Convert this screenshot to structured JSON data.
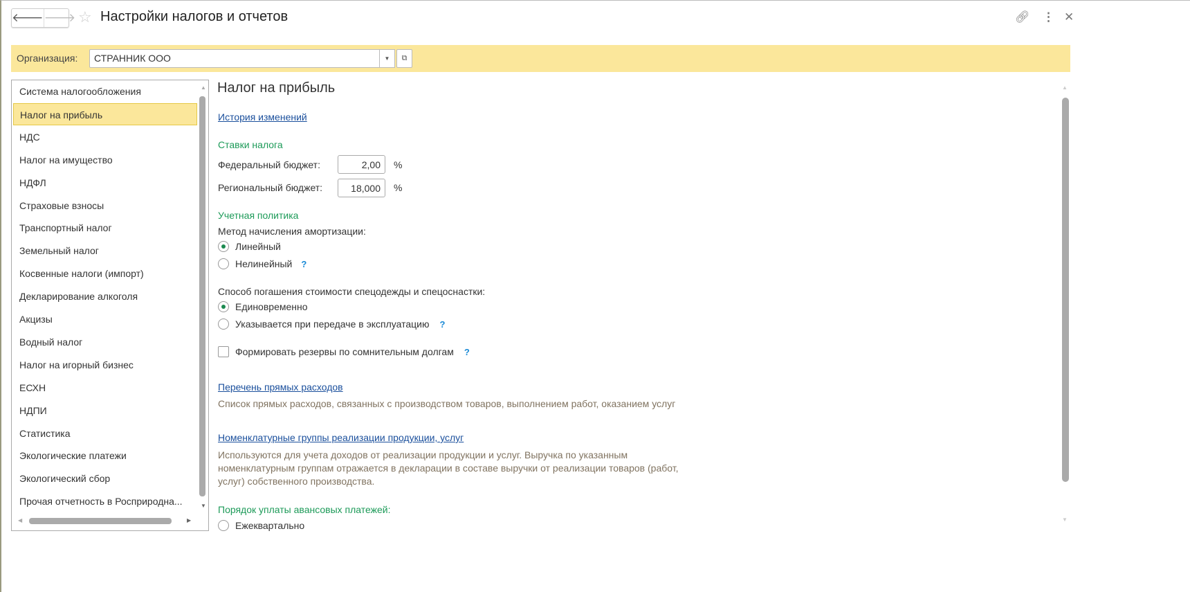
{
  "header": {
    "title": "Настройки налогов и отчетов",
    "back_icon": "arrow-left",
    "forward_icon": "arrow-right"
  },
  "org": {
    "label": "Организация:",
    "value": "СТРАННИК ООО"
  },
  "sidebar": {
    "items": [
      {
        "label": "Система налогообложения"
      },
      {
        "label": "Налог на прибыль",
        "selected": true
      },
      {
        "label": "НДС"
      },
      {
        "label": "Налог на имущество"
      },
      {
        "label": "НДФЛ"
      },
      {
        "label": "Страховые взносы"
      },
      {
        "label": "Транспортный налог"
      },
      {
        "label": "Земельный налог"
      },
      {
        "label": "Косвенные налоги (импорт)"
      },
      {
        "label": "Декларирование алкоголя"
      },
      {
        "label": "Акцизы"
      },
      {
        "label": "Водный налог"
      },
      {
        "label": "Налог на игорный бизнес"
      },
      {
        "label": "ЕСХН"
      },
      {
        "label": "НДПИ"
      },
      {
        "label": "Статистика"
      },
      {
        "label": "Экологические платежи"
      },
      {
        "label": "Экологический сбор"
      },
      {
        "label": "Прочая отчетность в Росприродна..."
      }
    ]
  },
  "main": {
    "title": "Налог на прибыль",
    "history_link": "История изменений",
    "rates": {
      "heading": "Ставки налога",
      "federal_label": "Федеральный бюджет:",
      "federal_value": "2,00",
      "regional_label": "Региональный бюджет:",
      "regional_value": "18,000",
      "percent": "%"
    },
    "policy": {
      "heading": "Учетная политика",
      "amort_label": "Метод начисления амортизации:",
      "amort_linear": "Линейный",
      "amort_nonlinear": "Нелинейный",
      "workwear_label": "Способ погашения стоимости спецодежды и спецоснастки:",
      "workwear_once": "Единовременно",
      "workwear_onuse": "Указывается при передаче в эксплуатацию",
      "reserves_label": "Формировать резервы по сомнительным долгам",
      "help": "?"
    },
    "direct_link": "Перечень прямых расходов",
    "direct_desc": "Список прямых расходов, связанных с производством товаров, выполнением работ, оказанием услуг",
    "nomen_link": "Номенклатурные группы реализации продукции, услуг",
    "nomen_desc": "Используются для учета доходов от реализации продукции и услуг. Выручка по указанным номенклатурным группам отражается в декларации в составе выручки от реализации товаров (работ, услуг) собственного производства.",
    "advance": {
      "heading": "Порядок уплаты авансовых платежей:",
      "quarterly": "Ежеквартально"
    }
  }
}
